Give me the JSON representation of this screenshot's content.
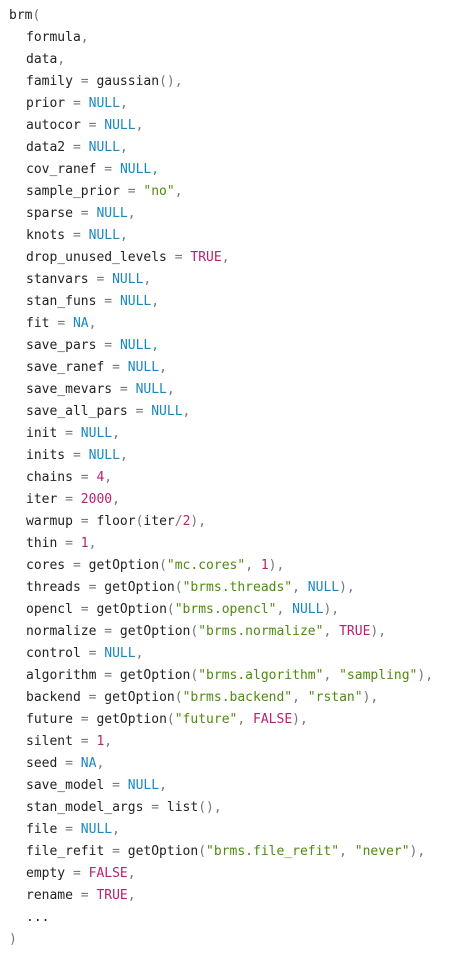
{
  "colors": {
    "background": "#ffffff",
    "plain": "#222222",
    "punctuation": "#777777",
    "null": "#1a87c0",
    "number": "#b8226e",
    "boolean": "#b8226e",
    "string": "#4f8a10"
  },
  "lines": [
    {
      "indent": 0,
      "tokens": [
        [
          "plain",
          "brm"
        ],
        [
          "punct",
          "("
        ]
      ]
    },
    {
      "indent": 1,
      "tokens": [
        [
          "plain",
          "formula"
        ],
        [
          "punct",
          ","
        ]
      ]
    },
    {
      "indent": 1,
      "tokens": [
        [
          "plain",
          "data"
        ],
        [
          "punct",
          ","
        ]
      ]
    },
    {
      "indent": 1,
      "tokens": [
        [
          "plain",
          "family "
        ],
        [
          "punct",
          "="
        ],
        [
          "plain",
          " gaussian"
        ],
        [
          "punct",
          "(),"
        ]
      ]
    },
    {
      "indent": 1,
      "tokens": [
        [
          "plain",
          "prior "
        ],
        [
          "punct",
          "="
        ],
        [
          "plain",
          " "
        ],
        [
          "null",
          "NULL"
        ],
        [
          "punct",
          ","
        ]
      ]
    },
    {
      "indent": 1,
      "tokens": [
        [
          "plain",
          "autocor "
        ],
        [
          "punct",
          "="
        ],
        [
          "plain",
          " "
        ],
        [
          "null",
          "NULL"
        ],
        [
          "punct",
          ","
        ]
      ]
    },
    {
      "indent": 1,
      "tokens": [
        [
          "plain",
          "data2 "
        ],
        [
          "punct",
          "="
        ],
        [
          "plain",
          " "
        ],
        [
          "null",
          "NULL"
        ],
        [
          "punct",
          ","
        ]
      ]
    },
    {
      "indent": 1,
      "tokens": [
        [
          "plain",
          "cov_ranef "
        ],
        [
          "punct",
          "="
        ],
        [
          "plain",
          " "
        ],
        [
          "null",
          "NULL"
        ],
        [
          "punct",
          ","
        ]
      ]
    },
    {
      "indent": 1,
      "tokens": [
        [
          "plain",
          "sample_prior "
        ],
        [
          "punct",
          "="
        ],
        [
          "plain",
          " "
        ],
        [
          "string",
          "\"no\""
        ],
        [
          "punct",
          ","
        ]
      ]
    },
    {
      "indent": 1,
      "tokens": [
        [
          "plain",
          "sparse "
        ],
        [
          "punct",
          "="
        ],
        [
          "plain",
          " "
        ],
        [
          "null",
          "NULL"
        ],
        [
          "punct",
          ","
        ]
      ]
    },
    {
      "indent": 1,
      "tokens": [
        [
          "plain",
          "knots "
        ],
        [
          "punct",
          "="
        ],
        [
          "plain",
          " "
        ],
        [
          "null",
          "NULL"
        ],
        [
          "punct",
          ","
        ]
      ]
    },
    {
      "indent": 1,
      "tokens": [
        [
          "plain",
          "drop_unused_levels "
        ],
        [
          "punct",
          "="
        ],
        [
          "plain",
          " "
        ],
        [
          "bool",
          "TRUE"
        ],
        [
          "punct",
          ","
        ]
      ]
    },
    {
      "indent": 1,
      "tokens": [
        [
          "plain",
          "stanvars "
        ],
        [
          "punct",
          "="
        ],
        [
          "plain",
          " "
        ],
        [
          "null",
          "NULL"
        ],
        [
          "punct",
          ","
        ]
      ]
    },
    {
      "indent": 1,
      "tokens": [
        [
          "plain",
          "stan_funs "
        ],
        [
          "punct",
          "="
        ],
        [
          "plain",
          " "
        ],
        [
          "null",
          "NULL"
        ],
        [
          "punct",
          ","
        ]
      ]
    },
    {
      "indent": 1,
      "tokens": [
        [
          "plain",
          "fit "
        ],
        [
          "punct",
          "="
        ],
        [
          "plain",
          " "
        ],
        [
          "null",
          "NA"
        ],
        [
          "punct",
          ","
        ]
      ]
    },
    {
      "indent": 1,
      "tokens": [
        [
          "plain",
          "save_pars "
        ],
        [
          "punct",
          "="
        ],
        [
          "plain",
          " "
        ],
        [
          "null",
          "NULL"
        ],
        [
          "punct",
          ","
        ]
      ]
    },
    {
      "indent": 1,
      "tokens": [
        [
          "plain",
          "save_ranef "
        ],
        [
          "punct",
          "="
        ],
        [
          "plain",
          " "
        ],
        [
          "null",
          "NULL"
        ],
        [
          "punct",
          ","
        ]
      ]
    },
    {
      "indent": 1,
      "tokens": [
        [
          "plain",
          "save_mevars "
        ],
        [
          "punct",
          "="
        ],
        [
          "plain",
          " "
        ],
        [
          "null",
          "NULL"
        ],
        [
          "punct",
          ","
        ]
      ]
    },
    {
      "indent": 1,
      "tokens": [
        [
          "plain",
          "save_all_pars "
        ],
        [
          "punct",
          "="
        ],
        [
          "plain",
          " "
        ],
        [
          "null",
          "NULL"
        ],
        [
          "punct",
          ","
        ]
      ]
    },
    {
      "indent": 1,
      "tokens": [
        [
          "plain",
          "init "
        ],
        [
          "punct",
          "="
        ],
        [
          "plain",
          " "
        ],
        [
          "null",
          "NULL"
        ],
        [
          "punct",
          ","
        ]
      ]
    },
    {
      "indent": 1,
      "tokens": [
        [
          "plain",
          "inits "
        ],
        [
          "punct",
          "="
        ],
        [
          "plain",
          " "
        ],
        [
          "null",
          "NULL"
        ],
        [
          "punct",
          ","
        ]
      ]
    },
    {
      "indent": 1,
      "tokens": [
        [
          "plain",
          "chains "
        ],
        [
          "punct",
          "="
        ],
        [
          "plain",
          " "
        ],
        [
          "number",
          "4"
        ],
        [
          "punct",
          ","
        ]
      ]
    },
    {
      "indent": 1,
      "tokens": [
        [
          "plain",
          "iter "
        ],
        [
          "punct",
          "="
        ],
        [
          "plain",
          " "
        ],
        [
          "number",
          "2000"
        ],
        [
          "punct",
          ","
        ]
      ]
    },
    {
      "indent": 1,
      "tokens": [
        [
          "plain",
          "warmup "
        ],
        [
          "punct",
          "="
        ],
        [
          "plain",
          " floor"
        ],
        [
          "punct",
          "("
        ],
        [
          "plain",
          "iter"
        ],
        [
          "punct",
          "/"
        ],
        [
          "number",
          "2"
        ],
        [
          "punct",
          "),"
        ]
      ]
    },
    {
      "indent": 1,
      "tokens": [
        [
          "plain",
          "thin "
        ],
        [
          "punct",
          "="
        ],
        [
          "plain",
          " "
        ],
        [
          "number",
          "1"
        ],
        [
          "punct",
          ","
        ]
      ]
    },
    {
      "indent": 1,
      "tokens": [
        [
          "plain",
          "cores "
        ],
        [
          "punct",
          "="
        ],
        [
          "plain",
          " getOption"
        ],
        [
          "punct",
          "("
        ],
        [
          "string",
          "\"mc.cores\""
        ],
        [
          "punct",
          ","
        ],
        [
          "plain",
          " "
        ],
        [
          "number",
          "1"
        ],
        [
          "punct",
          "),"
        ]
      ]
    },
    {
      "indent": 1,
      "tokens": [
        [
          "plain",
          "threads "
        ],
        [
          "punct",
          "="
        ],
        [
          "plain",
          " getOption"
        ],
        [
          "punct",
          "("
        ],
        [
          "string",
          "\"brms.threads\""
        ],
        [
          "punct",
          ","
        ],
        [
          "plain",
          " "
        ],
        [
          "null",
          "NULL"
        ],
        [
          "punct",
          "),"
        ]
      ]
    },
    {
      "indent": 1,
      "tokens": [
        [
          "plain",
          "opencl "
        ],
        [
          "punct",
          "="
        ],
        [
          "plain",
          " getOption"
        ],
        [
          "punct",
          "("
        ],
        [
          "string",
          "\"brms.opencl\""
        ],
        [
          "punct",
          ","
        ],
        [
          "plain",
          " "
        ],
        [
          "null",
          "NULL"
        ],
        [
          "punct",
          "),"
        ]
      ]
    },
    {
      "indent": 1,
      "tokens": [
        [
          "plain",
          "normalize "
        ],
        [
          "punct",
          "="
        ],
        [
          "plain",
          " getOption"
        ],
        [
          "punct",
          "("
        ],
        [
          "string",
          "\"brms.normalize\""
        ],
        [
          "punct",
          ","
        ],
        [
          "plain",
          " "
        ],
        [
          "bool",
          "TRUE"
        ],
        [
          "punct",
          "),"
        ]
      ]
    },
    {
      "indent": 1,
      "tokens": [
        [
          "plain",
          "control "
        ],
        [
          "punct",
          "="
        ],
        [
          "plain",
          " "
        ],
        [
          "null",
          "NULL"
        ],
        [
          "punct",
          ","
        ]
      ]
    },
    {
      "indent": 1,
      "tokens": [
        [
          "plain",
          "algorithm "
        ],
        [
          "punct",
          "="
        ],
        [
          "plain",
          " getOption"
        ],
        [
          "punct",
          "("
        ],
        [
          "string",
          "\"brms.algorithm\""
        ],
        [
          "punct",
          ","
        ],
        [
          "plain",
          " "
        ],
        [
          "string",
          "\"sampling\""
        ],
        [
          "punct",
          "),"
        ]
      ]
    },
    {
      "indent": 1,
      "tokens": [
        [
          "plain",
          "backend "
        ],
        [
          "punct",
          "="
        ],
        [
          "plain",
          " getOption"
        ],
        [
          "punct",
          "("
        ],
        [
          "string",
          "\"brms.backend\""
        ],
        [
          "punct",
          ","
        ],
        [
          "plain",
          " "
        ],
        [
          "string",
          "\"rstan\""
        ],
        [
          "punct",
          "),"
        ]
      ]
    },
    {
      "indent": 1,
      "tokens": [
        [
          "plain",
          "future "
        ],
        [
          "punct",
          "="
        ],
        [
          "plain",
          " getOption"
        ],
        [
          "punct",
          "("
        ],
        [
          "string",
          "\"future\""
        ],
        [
          "punct",
          ","
        ],
        [
          "plain",
          " "
        ],
        [
          "bool",
          "FALSE"
        ],
        [
          "punct",
          "),"
        ]
      ]
    },
    {
      "indent": 1,
      "tokens": [
        [
          "plain",
          "silent "
        ],
        [
          "punct",
          "="
        ],
        [
          "plain",
          " "
        ],
        [
          "number",
          "1"
        ],
        [
          "punct",
          ","
        ]
      ]
    },
    {
      "indent": 1,
      "tokens": [
        [
          "plain",
          "seed "
        ],
        [
          "punct",
          "="
        ],
        [
          "plain",
          " "
        ],
        [
          "null",
          "NA"
        ],
        [
          "punct",
          ","
        ]
      ]
    },
    {
      "indent": 1,
      "tokens": [
        [
          "plain",
          "save_model "
        ],
        [
          "punct",
          "="
        ],
        [
          "plain",
          " "
        ],
        [
          "null",
          "NULL"
        ],
        [
          "punct",
          ","
        ]
      ]
    },
    {
      "indent": 1,
      "tokens": [
        [
          "plain",
          "stan_model_args "
        ],
        [
          "punct",
          "="
        ],
        [
          "plain",
          " list"
        ],
        [
          "punct",
          "(),"
        ]
      ]
    },
    {
      "indent": 1,
      "tokens": [
        [
          "plain",
          "file "
        ],
        [
          "punct",
          "="
        ],
        [
          "plain",
          " "
        ],
        [
          "null",
          "NULL"
        ],
        [
          "punct",
          ","
        ]
      ]
    },
    {
      "indent": 1,
      "tokens": [
        [
          "plain",
          "file_refit "
        ],
        [
          "punct",
          "="
        ],
        [
          "plain",
          " getOption"
        ],
        [
          "punct",
          "("
        ],
        [
          "string",
          "\"brms.file_refit\""
        ],
        [
          "punct",
          ","
        ],
        [
          "plain",
          " "
        ],
        [
          "string",
          "\"never\""
        ],
        [
          "punct",
          "),"
        ]
      ]
    },
    {
      "indent": 1,
      "tokens": [
        [
          "plain",
          "empty "
        ],
        [
          "punct",
          "="
        ],
        [
          "plain",
          " "
        ],
        [
          "bool",
          "FALSE"
        ],
        [
          "punct",
          ","
        ]
      ]
    },
    {
      "indent": 1,
      "tokens": [
        [
          "plain",
          "rename "
        ],
        [
          "punct",
          "="
        ],
        [
          "plain",
          " "
        ],
        [
          "bool",
          "TRUE"
        ],
        [
          "punct",
          ","
        ]
      ]
    },
    {
      "indent": 1,
      "tokens": [
        [
          "plain",
          "..."
        ]
      ]
    },
    {
      "indent": 0,
      "tokens": [
        [
          "punct",
          ")"
        ]
      ]
    }
  ]
}
